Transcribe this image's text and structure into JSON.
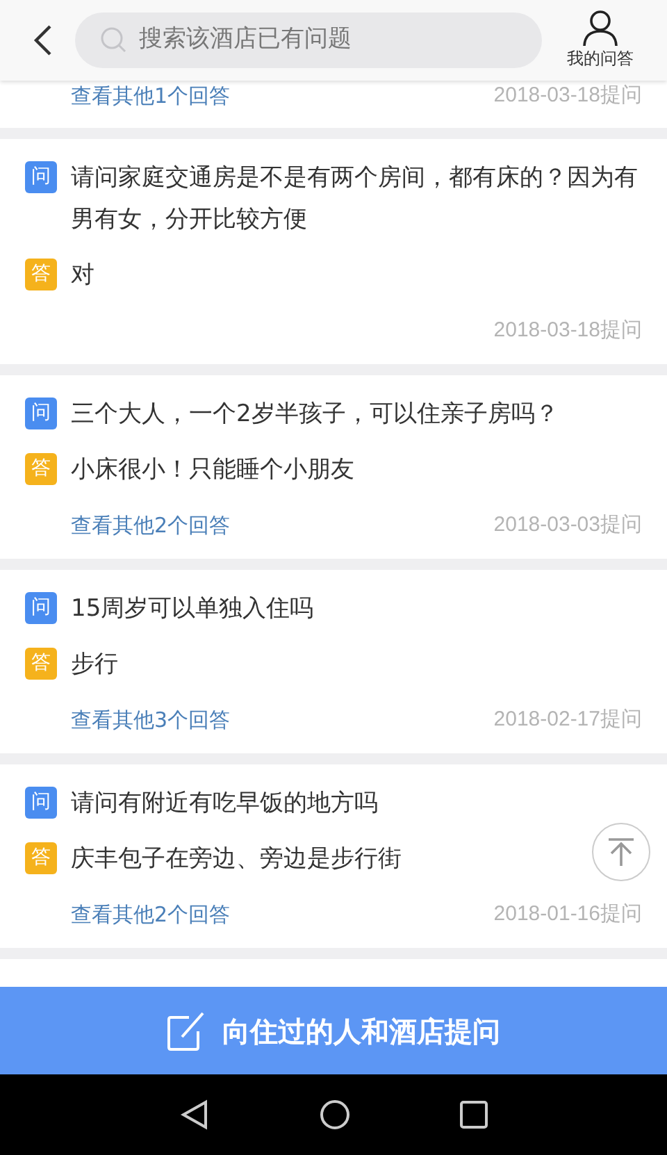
{
  "header": {
    "search": {
      "placeholder": "搜索该酒店已有问题"
    },
    "my_qa": "我的问答"
  },
  "questions": [
    {
      "more_answers": "查看其他1个回答",
      "date": "2018-03-18提问"
    },
    {
      "question_badge": "问",
      "question": "请问家庭交通房是不是有两个房间，都有床的？因为有男有女，分开比较方便",
      "answer_badge": "答",
      "answer": "对",
      "date": "2018-03-18提问"
    },
    {
      "question_badge": "问",
      "question": "三个大人，一个2岁半孩子，可以住亲子房吗？",
      "answer_badge": "答",
      "answer": "小床很小！只能睡个小朋友",
      "more_answers": "查看其他2个回答",
      "date": "2018-03-03提问"
    },
    {
      "question_badge": "问",
      "question": "15周岁可以单独入住吗",
      "answer_badge": "答",
      "answer": "步行",
      "more_answers": "查看其他3个回答",
      "date": "2018-02-17提问"
    },
    {
      "question_badge": "问",
      "question": "请问有附近有吃早饭的地方吗",
      "answer_badge": "答",
      "answer": "庆丰包子在旁边、旁边是步行街",
      "more_answers": "查看其他2个回答",
      "date": "2018-01-16提问"
    }
  ],
  "ask_button": "向住过的人和酒店提问"
}
